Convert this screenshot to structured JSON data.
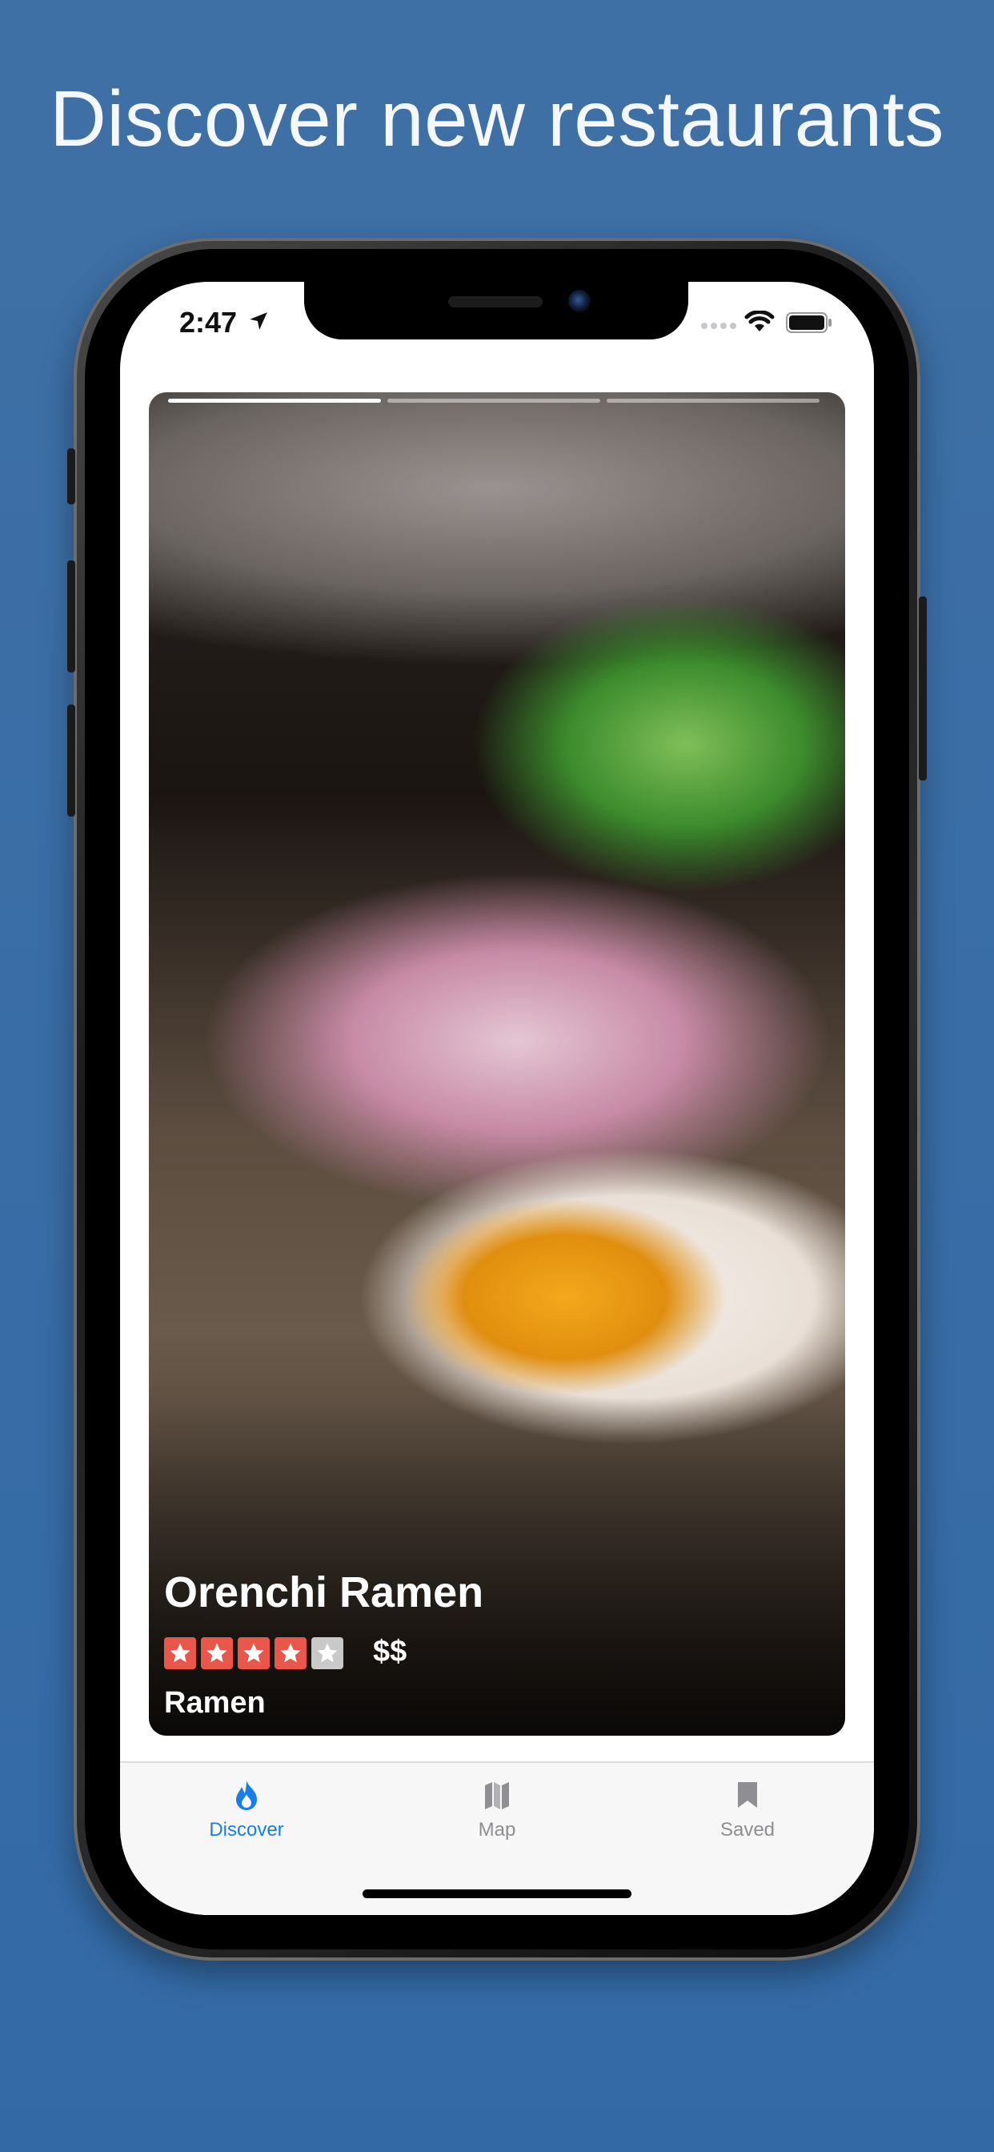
{
  "headline": "Discover new restaurants",
  "status_bar": {
    "time": "2:47"
  },
  "story": {
    "segments": 3,
    "active_segment": 1
  },
  "restaurant": {
    "name": "Orenchi Ramen",
    "rating": 4,
    "rating_max": 5,
    "price": "$$",
    "category": "Ramen"
  },
  "tabs": [
    {
      "label": "Discover",
      "icon": "flame-icon",
      "active": true
    },
    {
      "label": "Map",
      "icon": "map-icon",
      "active": false
    },
    {
      "label": "Saved",
      "icon": "bookmark-icon",
      "active": false
    }
  ],
  "colors": {
    "background": "#3a6ba4",
    "accent": "#1a7ee8",
    "star_filled": "#e9574a",
    "star_empty": "#c9c9c9",
    "tab_inactive": "#8e8e93"
  }
}
